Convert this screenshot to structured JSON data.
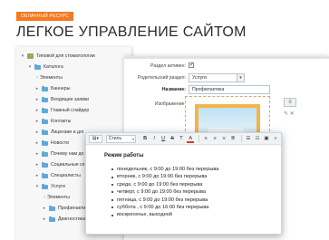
{
  "header": {
    "tag": "Облачный ресурс",
    "title": "ЛЕГКОЕ УПРАВЛЕНИЕ САЙТОМ"
  },
  "tree": {
    "items": [
      {
        "label": "Типовой для стоматологии",
        "icon": "database-icon"
      },
      {
        "label": "Каталогa",
        "icon": "folder-icon"
      },
      {
        "label": "Элементы",
        "icon": "arrow-icon"
      },
      {
        "label": "Баннеры",
        "icon": "folder-icon"
      },
      {
        "label": "Входящие заявки",
        "icon": "folder-icon"
      },
      {
        "label": "Главный слайдер",
        "icon": "folder-icon"
      },
      {
        "label": "Контакты",
        "icon": "folder-icon"
      },
      {
        "label": "Лицензии и дог",
        "icon": "folder-icon"
      },
      {
        "label": "Новости",
        "icon": "folder-icon"
      },
      {
        "label": "Почему нам до",
        "icon": "folder-icon"
      },
      {
        "label": "Социальные се",
        "icon": "folder-icon"
      },
      {
        "label": "Специалисты",
        "icon": "folder-icon"
      },
      {
        "label": "Услуги",
        "icon": "folder-icon"
      },
      {
        "label": "Элементы",
        "icon": "arrow-icon"
      },
      {
        "label": "Профилакти",
        "icon": "folder-icon"
      },
      {
        "label": "Диагностика",
        "icon": "folder-icon"
      }
    ]
  },
  "form": {
    "active_label": "Раздел активен:",
    "parent_label": "Родительский раздел:",
    "parent_value": "Услуги",
    "name_label": "Название:",
    "name_value": "Профилактика",
    "image_label": "Изображение:"
  },
  "editor": {
    "style_select": "Стиль",
    "heading": "Режим работы",
    "schedule": [
      "понедельник, с 9:00 до 19:00 без перерыва",
      "вторник, с 9:00 до 19:00 без перерыва",
      "среда, с 9:00 до 19:00 без перерыва",
      "четверг, с 9:00 до 19:00 без перерыва",
      "пятница, с 9:00 до 19:00 без перерыва",
      "суббота , с 9:00 до 16:00 без перерыва",
      "воскресенье, выходной"
    ]
  },
  "colors": {
    "accent": "#f47920",
    "folder": "#5fa9d8"
  }
}
